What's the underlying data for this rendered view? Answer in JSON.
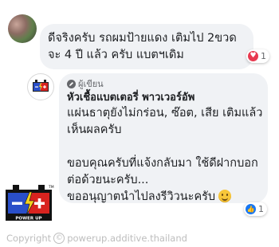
{
  "comment": {
    "lines": [
      "ดีจริงครับ รถผมป้ายแดง เติมไป 2ขวด",
      "จะ 4 ปี แล้ว ครับ แบตฯเดิม"
    ],
    "reaction_count": "1",
    "reaction_icon": "heart-icon"
  },
  "reply": {
    "author_tag": "ผู้เขียน",
    "author_name": "หัวเชื้อแบตเตอรี่ พาวเวอร์อัพ",
    "lines": [
      "แผ่นธาตุยังไม่กร่อน, ซ๊อต, เสีย เติมแล้ว",
      "เห็นผลครับ",
      "ขอบคุณครับที่แจ้งกลับมา ใช้ดีฝากบอก",
      "ต่อด้วยนะครับ...",
      "ขออนุญาตนำไปลงรีวิวนะครับ"
    ],
    "reaction_count": "1",
    "reaction_icon": "like-icon"
  },
  "logo": {
    "text": "POWER UP",
    "tm": "TM"
  },
  "watermark": {
    "copyright": "Copyright",
    "symbol": "©",
    "handle": "powerup.additive.thailand"
  },
  "colors": {
    "bubble": "#f0f2f5",
    "heart": "#e8394f",
    "like": "#1877f2",
    "logo_blue": "#2a4fc9",
    "logo_red": "#d8231f"
  }
}
